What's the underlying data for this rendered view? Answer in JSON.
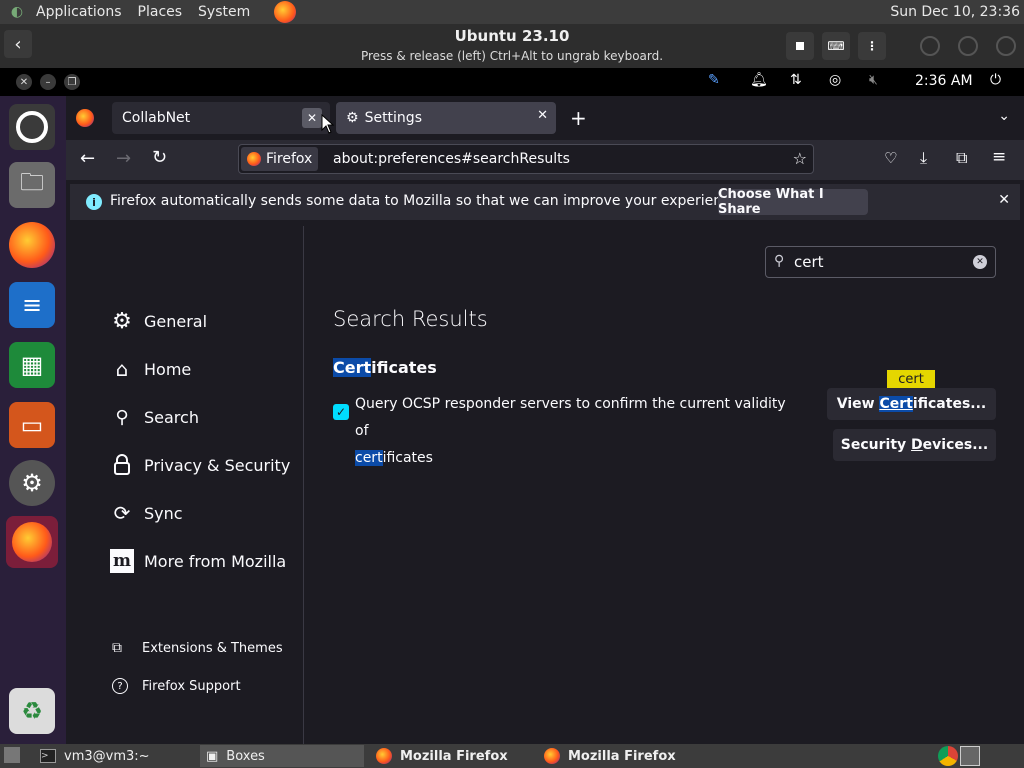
{
  "host_panel": {
    "menus": [
      "Applications",
      "Places",
      "System"
    ],
    "clock": "Sun Dec 10, 23:36"
  },
  "boxes": {
    "title": "Ubuntu 23.10",
    "subtitle": "Press & release (left) Ctrl+Alt to ungrab keyboard."
  },
  "guest_top": {
    "time": "2:36 AM"
  },
  "tabs": [
    {
      "label": "CollabNet"
    },
    {
      "label": "Settings"
    }
  ],
  "urlbar": {
    "identity": "Firefox",
    "url": "about:preferences#searchResults"
  },
  "notification": {
    "text": "Firefox automatically sends some data to Mozilla so that we can improve your experience.",
    "button": "Choose What I Share"
  },
  "search": {
    "value": "cert"
  },
  "sidebar": {
    "categories": [
      "General",
      "Home",
      "Search",
      "Privacy & Security",
      "Sync",
      "More from Mozilla"
    ],
    "footer_links": [
      "Extensions & Themes",
      "Firefox Support"
    ]
  },
  "results": {
    "heading": "Search Results",
    "group_hl": "Cert",
    "group_rest": "ificates",
    "option_line1": "Query OCSP responder servers to confirm the current validity of",
    "option_hl": "cert",
    "option_rest": "ificates",
    "tooltip": "cert",
    "view_btn_pre": "View ",
    "view_btn_hl": "Cert",
    "view_btn_post": "ificates...",
    "security_btn_pre": "Security ",
    "security_btn_ul": "D",
    "security_btn_post": "evices..."
  },
  "taskbar": {
    "items": [
      "vm3@vm3:~",
      "Boxes",
      "Mozilla Firefox",
      "Mozilla Firefox"
    ]
  },
  "colors": {
    "highlight": "#0b4ba8",
    "checkbox": "#00ddff",
    "tooltip": "#e5d600"
  }
}
